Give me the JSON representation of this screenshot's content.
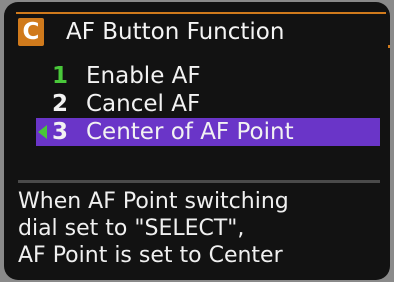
{
  "menu": {
    "tab_icon": "C",
    "title": "AF Button Function"
  },
  "options": [
    {
      "number": "1",
      "label": "Enable AF"
    },
    {
      "number": "2",
      "label": "Cancel AF"
    },
    {
      "number": "3",
      "label": "Center of AF Point"
    }
  ],
  "selected_index": 3,
  "help_text": [
    "When AF Point switching",
    "dial set to \"SELECT\",",
    "AF Point is set to Center"
  ],
  "colors": {
    "accent": "#d07a1c",
    "selection": "#6a35c8",
    "active_number": "#49c83a"
  }
}
